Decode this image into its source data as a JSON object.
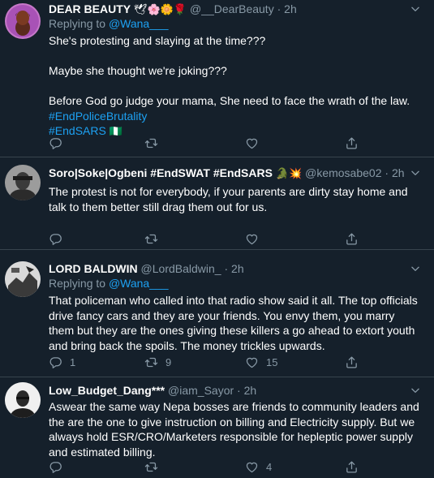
{
  "tweets": [
    {
      "name": "DEAR BEAUTY",
      "name_emoji": "🕊🌸🌼🌹",
      "handle": "@__DearBeauty",
      "time": "2h",
      "replying_prefix": "Replying to ",
      "replying_to": "@Wana___",
      "lines": [
        "She's protesting and slaying at the time???",
        "",
        "Maybe she thought we're joking???",
        "",
        "Before God go judge your mama, She need to face the wrath of the law."
      ],
      "hashtags": [
        "#EndPoliceBrutality",
        "#EndSARS"
      ],
      "hashtag_emoji": "🇳🇬",
      "reply_count": "",
      "retweet_count": "",
      "like_count": ""
    },
    {
      "name": "Soro|Soke|Ogbeni #EndSWAT #EndSARS",
      "name_emoji": "🐊💥",
      "handle": "@kemosabe02",
      "time": "2h",
      "text": "The protest is not for everybody, if your parents are dirty stay home and talk to them better still drag them out for us.",
      "reply_count": "",
      "retweet_count": "",
      "like_count": ""
    },
    {
      "name": "LORD BALDWIN",
      "handle": "@LordBaldwin_",
      "time": "2h",
      "replying_prefix": "Replying to ",
      "replying_to": "@Wana___",
      "text": "That policeman who called into that radio show said it all. The top officials drive fancy cars and they are your friends. You envy them, you marry them but they are the ones giving these killers a go ahead to extort youth and bring back the spoils. The money trickles upwards.",
      "reply_count": "1",
      "retweet_count": "9",
      "like_count": "15"
    },
    {
      "name": "Low_Budget_Dang***",
      "handle": "@iam_Sayor",
      "time": "2h",
      "text": "Aswear the same way Nepa bosses are friends to community leaders and the are the one to give instruction on billing and Electricity supply. But we always hold ESR/CRO/Marketers responsible for hepleptic power supply and estimated billing.",
      "reply_count": "",
      "retweet_count": "",
      "like_count": "4"
    }
  ],
  "separator": " · ",
  "colors": {
    "background": "#15202b",
    "text": "#ffffff",
    "muted": "#8899a6",
    "link": "#1da1f2",
    "border": "#38444d"
  },
  "icons": {
    "reply": "reply-icon",
    "retweet": "retweet-icon",
    "like": "heart-icon",
    "share": "share-icon",
    "more": "chevron-down-icon"
  }
}
